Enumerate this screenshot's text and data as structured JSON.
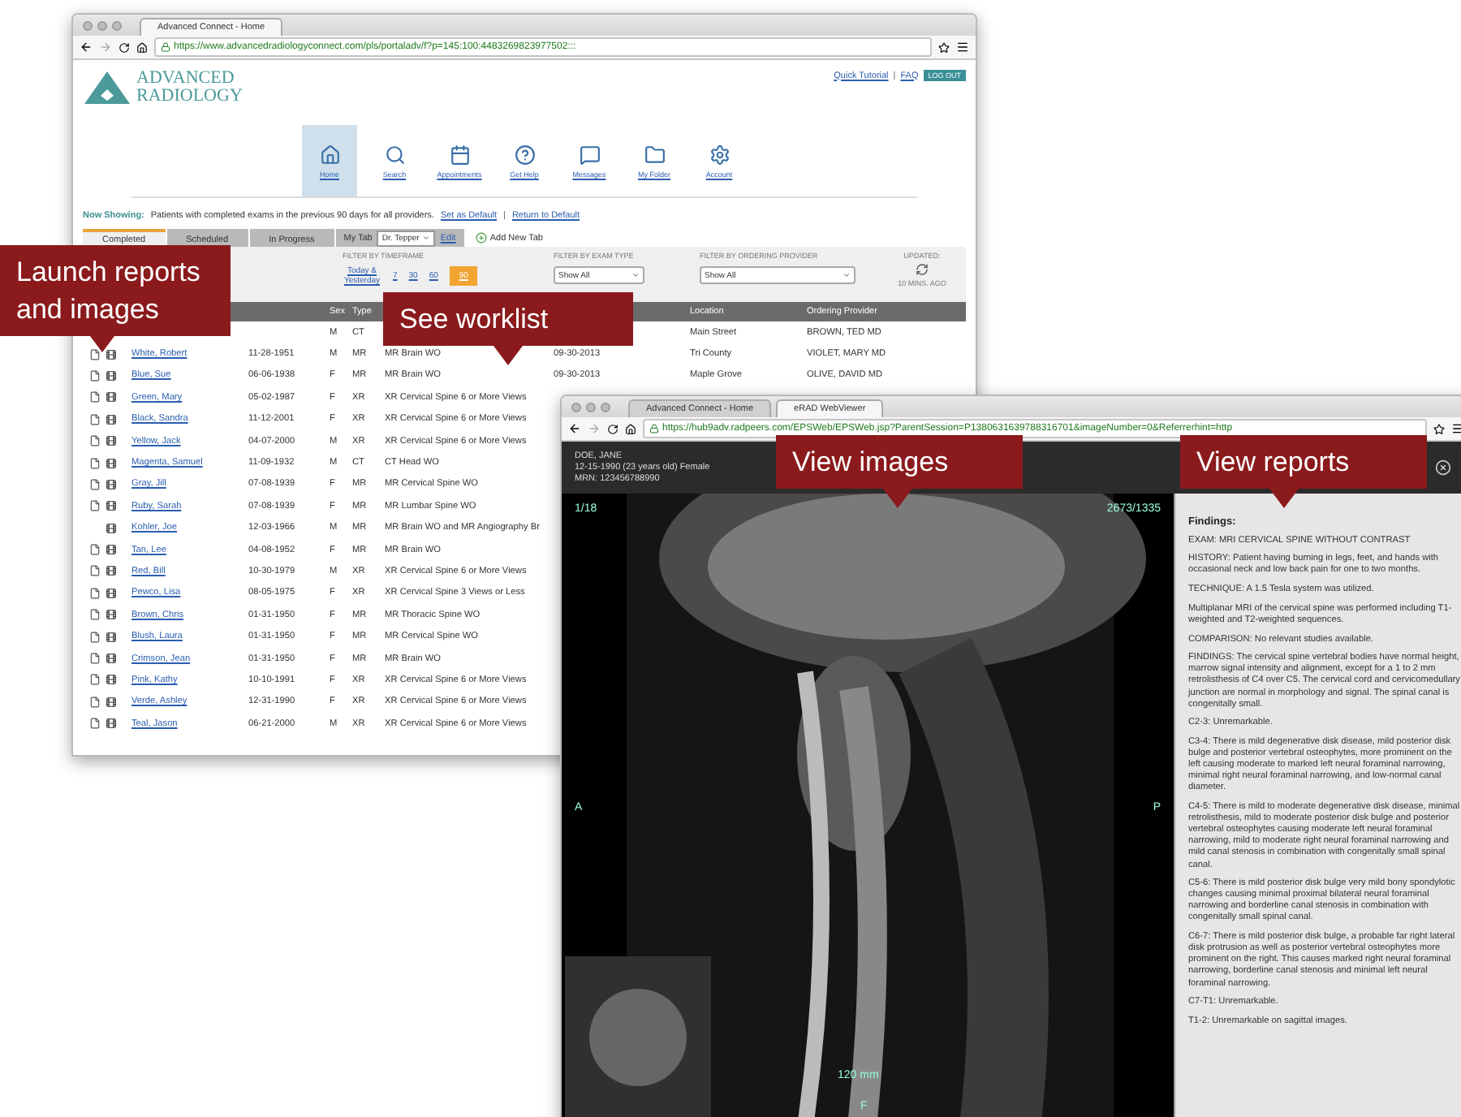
{
  "worklist_window": {
    "browser": {
      "tabs": [
        {
          "label": "Advanced Connect - Home",
          "selected": true
        }
      ],
      "url": "https://www.advancedradiologyconnect.com/pls/portaladv/f?p=145:100:4483269823977502:::"
    },
    "logo": {
      "line1": "ADVANCED",
      "line2": "RADIOLOGY"
    },
    "top_links": [
      "Quick Tutorial",
      "FAQ"
    ],
    "top_separator": "|",
    "logout": "LOG OUT",
    "nav": [
      {
        "label": "Home",
        "selected": true
      },
      {
        "label": "Search",
        "selected": false
      },
      {
        "label": "Appointments",
        "selected": false
      },
      {
        "label": "Get Help",
        "selected": false
      },
      {
        "label": "Messages",
        "selected": false
      },
      {
        "label": "My Folder",
        "selected": false
      },
      {
        "label": "Account",
        "selected": false
      }
    ],
    "now_showing": {
      "label": "Now Showing:",
      "text": "Patients with completed exams in the previous 90 days for all providers.",
      "links": [
        "Set as Default",
        "Return to Default"
      ],
      "separator": "|"
    },
    "tabs": [
      {
        "label": "Completed",
        "selected": true
      },
      {
        "label": "Scheduled",
        "selected": false
      },
      {
        "label": "In Progress",
        "selected": false
      }
    ],
    "my_tab": {
      "label": "My Tab",
      "value": "Dr. Tepper",
      "edit": "Edit"
    },
    "add_tab": "Add New Tab",
    "filters": {
      "timeframe": {
        "label": "FILTER BY TIMEFRAME",
        "options": [
          {
            "label": "Today & Yesterday",
            "selected": false
          },
          {
            "label": "7",
            "selected": false
          },
          {
            "label": "30",
            "selected": false
          },
          {
            "label": "60",
            "selected": false
          },
          {
            "label": "90",
            "selected": true
          }
        ]
      },
      "exam_type": {
        "label": "FILTER BY EXAM TYPE",
        "value": "Show All"
      },
      "provider": {
        "label": "FILTER BY ORDERING PROVIDER",
        "value": "Show All"
      },
      "updated": {
        "label": "UPDATED:",
        "time": "10 MINS. AGO"
      }
    },
    "table": {
      "columns": {
        "sex": "Sex",
        "type": "Type",
        "location": "Location",
        "provider": "Ordering Provider"
      },
      "rows": [
        {
          "sex": "M",
          "type": "CT",
          "location": "Main Street",
          "provider": "BROWN, TED MD"
        },
        {
          "report": true,
          "name": "White, Robert",
          "dob": "11-28-1951",
          "sex": "M",
          "type": "MR",
          "exam": "MR Brain WO",
          "date": "09-30-2013",
          "location": "Tri County",
          "provider": "VIOLET, MARY MD"
        },
        {
          "report": true,
          "name": "Blue, Sue",
          "dob": "06-06-1938",
          "sex": "F",
          "type": "MR",
          "exam": "MR Brain WO",
          "date": "09-30-2013",
          "location": "Maple Grove",
          "provider": "OLIVE, DAVID MD"
        },
        {
          "report": true,
          "name": "Green, Mary",
          "dob": "05-02-1987",
          "sex": "F",
          "type": "XR",
          "exam": "XR Cervical Spine 6 or More Views"
        },
        {
          "report": true,
          "name": "Black, Sandra",
          "dob": "11-12-2001",
          "sex": "F",
          "type": "XR",
          "exam": "XR Cervical Spine 6 or More Views"
        },
        {
          "report": true,
          "name": "Yellow, Jack",
          "dob": "04-07-2000",
          "sex": "M",
          "type": "XR",
          "exam": "XR Cervical Spine 6 or More Views"
        },
        {
          "report": true,
          "name": "Magenta, Samuel",
          "dob": "11-09-1932",
          "sex": "M",
          "type": "CT",
          "exam": "CT Head WO"
        },
        {
          "report": true,
          "name": "Gray, Jill",
          "dob": "07-08-1939",
          "sex": "F",
          "type": "MR",
          "exam": "MR Cervical Spine WO"
        },
        {
          "report": true,
          "name": "Ruby, Sarah",
          "dob": "07-08-1939",
          "sex": "F",
          "type": "MR",
          "exam": "MR Lumbar Spine WO"
        },
        {
          "report": false,
          "name": "Kohler, Joe",
          "dob": "12-03-1966",
          "sex": "M",
          "type": "MR",
          "exam": "MR Brain WO and MR Angiography Br"
        },
        {
          "report": true,
          "name": "Tan, Lee",
          "dob": "04-08-1952",
          "sex": "F",
          "type": "MR",
          "exam": "MR Brain WO"
        },
        {
          "report": true,
          "name": "Red, Bill",
          "dob": "10-30-1979",
          "sex": "M",
          "type": "XR",
          "exam": "XR Cervical Spine 6 or More Views"
        },
        {
          "report": true,
          "name": "Pewco, Lisa",
          "dob": "08-05-1975",
          "sex": "F",
          "type": "XR",
          "exam": "XR Cervical Spine 3 Views or Less"
        },
        {
          "report": true,
          "name": "Brown, Chris",
          "dob": "01-31-1950",
          "sex": "F",
          "type": "MR",
          "exam": "MR Thoracic Spine WO"
        },
        {
          "report": true,
          "name": "Blush, Laura",
          "dob": "01-31-1950",
          "sex": "F",
          "type": "MR",
          "exam": "MR Cervical Spine WO"
        },
        {
          "report": true,
          "name": "Crimson, Jean",
          "dob": "01-31-1950",
          "sex": "F",
          "type": "MR",
          "exam": "MR Brain WO"
        },
        {
          "report": true,
          "name": "Pink, Kathy",
          "dob": "10-10-1991",
          "sex": "F",
          "type": "XR",
          "exam": "XR Cervical Spine 6 or More Views"
        },
        {
          "report": true,
          "name": "Verde, Ashley",
          "dob": "12-31-1990",
          "sex": "F",
          "type": "XR",
          "exam": "XR Cervical Spine 6 or More Views"
        },
        {
          "report": true,
          "name": "Teal, Jason",
          "dob": "06-21-2000",
          "sex": "M",
          "type": "XR",
          "exam": "XR Cervical Spine 6 or More Views"
        }
      ]
    }
  },
  "viewer_window": {
    "browser": {
      "tabs": [
        {
          "label": "Advanced Connect - Home",
          "selected": false
        },
        {
          "label": "eRAD WebViewer",
          "selected": true
        }
      ],
      "url": "https://hub9adv.radpeers.com/EPSWeb/EPSWeb.jsp?ParentSession=P1380631639788316701&imageNumber=0&Referrerhint=http"
    },
    "patient": {
      "name": "DOE, JANE",
      "details": "12-15-1990 (23 years old) Female",
      "mrn": "MRN: 123456788990"
    },
    "image": {
      "series": "1/18",
      "window": "2673/1335",
      "left": "A",
      "right": "P",
      "scale": "120 mm",
      "bottom": "F"
    },
    "report": {
      "heading": "Findings:",
      "paragraphs": [
        "EXAM: MRI CERVICAL SPINE WITHOUT CONTRAST",
        "HISTORY: Patient having burning in legs, feet, and hands with occasional neck and low back pain for one to two months.",
        "TECHNIQUE: A 1.5 Tesla system was utilized.",
        "Multiplanar MRI of the cervical spine was performed including T1-weighted and T2-weighted sequences.",
        "COMPARISON: No relevant studies available.",
        "FINDINGS: The cervical spine vertebral bodies have normal height, marrow signal intensity and alignment, except for a 1 to 2 mm retrolisthesis of C4 over C5. The cervical cord and cervicomedullary junction are normal in morphology and signal. The spinal canal is congenitally small.",
        "C2-3: Unremarkable.",
        "C3-4: There is mild degenerative disk disease, mild posterior disk bulge and posterior vertebral osteophytes, more prominent on the left causing moderate to marked left neural foraminal narrowing, minimal right neural foraminal narrowing, and low-normal canal diameter.",
        "C4-5: There is mild to moderate degenerative disk disease, minimal retrolisthesis, mild to moderate posterior disk bulge and posterior vertebral osteophytes causing moderate left neural foraminal narrowing, mild to moderate right neural foraminal narrowing and mild canal stenosis in combination with congenitally small spinal canal.",
        "C5-6: There is mild posterior disk bulge very mild bony spondylotic changes causing minimal proximal bilateral neural foraminal narrowing and borderline canal stenosis in combination with congenitally small spinal canal.",
        "C6-7: There is mild posterior disk bulge, a probable far right lateral disk protrusion as well as posterior vertebral osteophytes more prominent on the right. This causes marked right neural foraminal narrowing, borderline canal stenosis and minimal left neural foraminal narrowing.",
        "C7-T1: Unremarkable.",
        "T1-2: Unremarkable on sagittal images."
      ]
    }
  },
  "callouts": [
    {
      "label": "Launch reports and images"
    },
    {
      "label": "See worklist"
    },
    {
      "label": "View images"
    },
    {
      "label": "View reports"
    }
  ]
}
